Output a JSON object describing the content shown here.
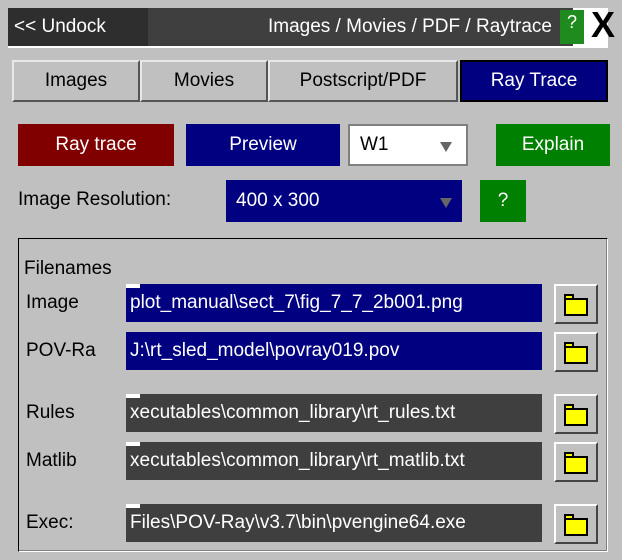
{
  "titlebar": {
    "undock_label": "<< Undock",
    "title": "Images / Movies / PDF / Raytrace",
    "help_label": "?",
    "close_label": "X"
  },
  "tabs": [
    {
      "label": "Images"
    },
    {
      "label": "Movies"
    },
    {
      "label": "Postscript/PDF"
    },
    {
      "label": "Ray Trace",
      "active": true
    }
  ],
  "toolbar": {
    "raytrace_label": "Ray trace",
    "preview_label": "Preview",
    "window_value": "W1",
    "explain_label": "Explain"
  },
  "resolution": {
    "label": "Image Resolution:",
    "value": "400 x 300",
    "help_label": "?"
  },
  "filenames": {
    "heading": "Filenames",
    "rows": [
      {
        "label": "Image",
        "value": "plot_manual\\sect_7\\fig_7_7_2b001.png"
      },
      {
        "label": "POV-Ra",
        "value": "J:\\rt_sled_model\\povray019.pov"
      },
      {
        "label": "Rules",
        "value": "xecutables\\common_library\\rt_rules.txt"
      },
      {
        "label": "Matlib",
        "value": "xecutables\\common_library\\rt_matlib.txt"
      },
      {
        "label": "Exec:",
        "value": "Files\\POV-Ray\\v3.7\\bin\\pvengine64.exe"
      }
    ]
  },
  "colors": {
    "accent_blue": "#000080",
    "accent_red": "#800000",
    "accent_green": "#008000",
    "folder_yellow": "#ffff00"
  }
}
